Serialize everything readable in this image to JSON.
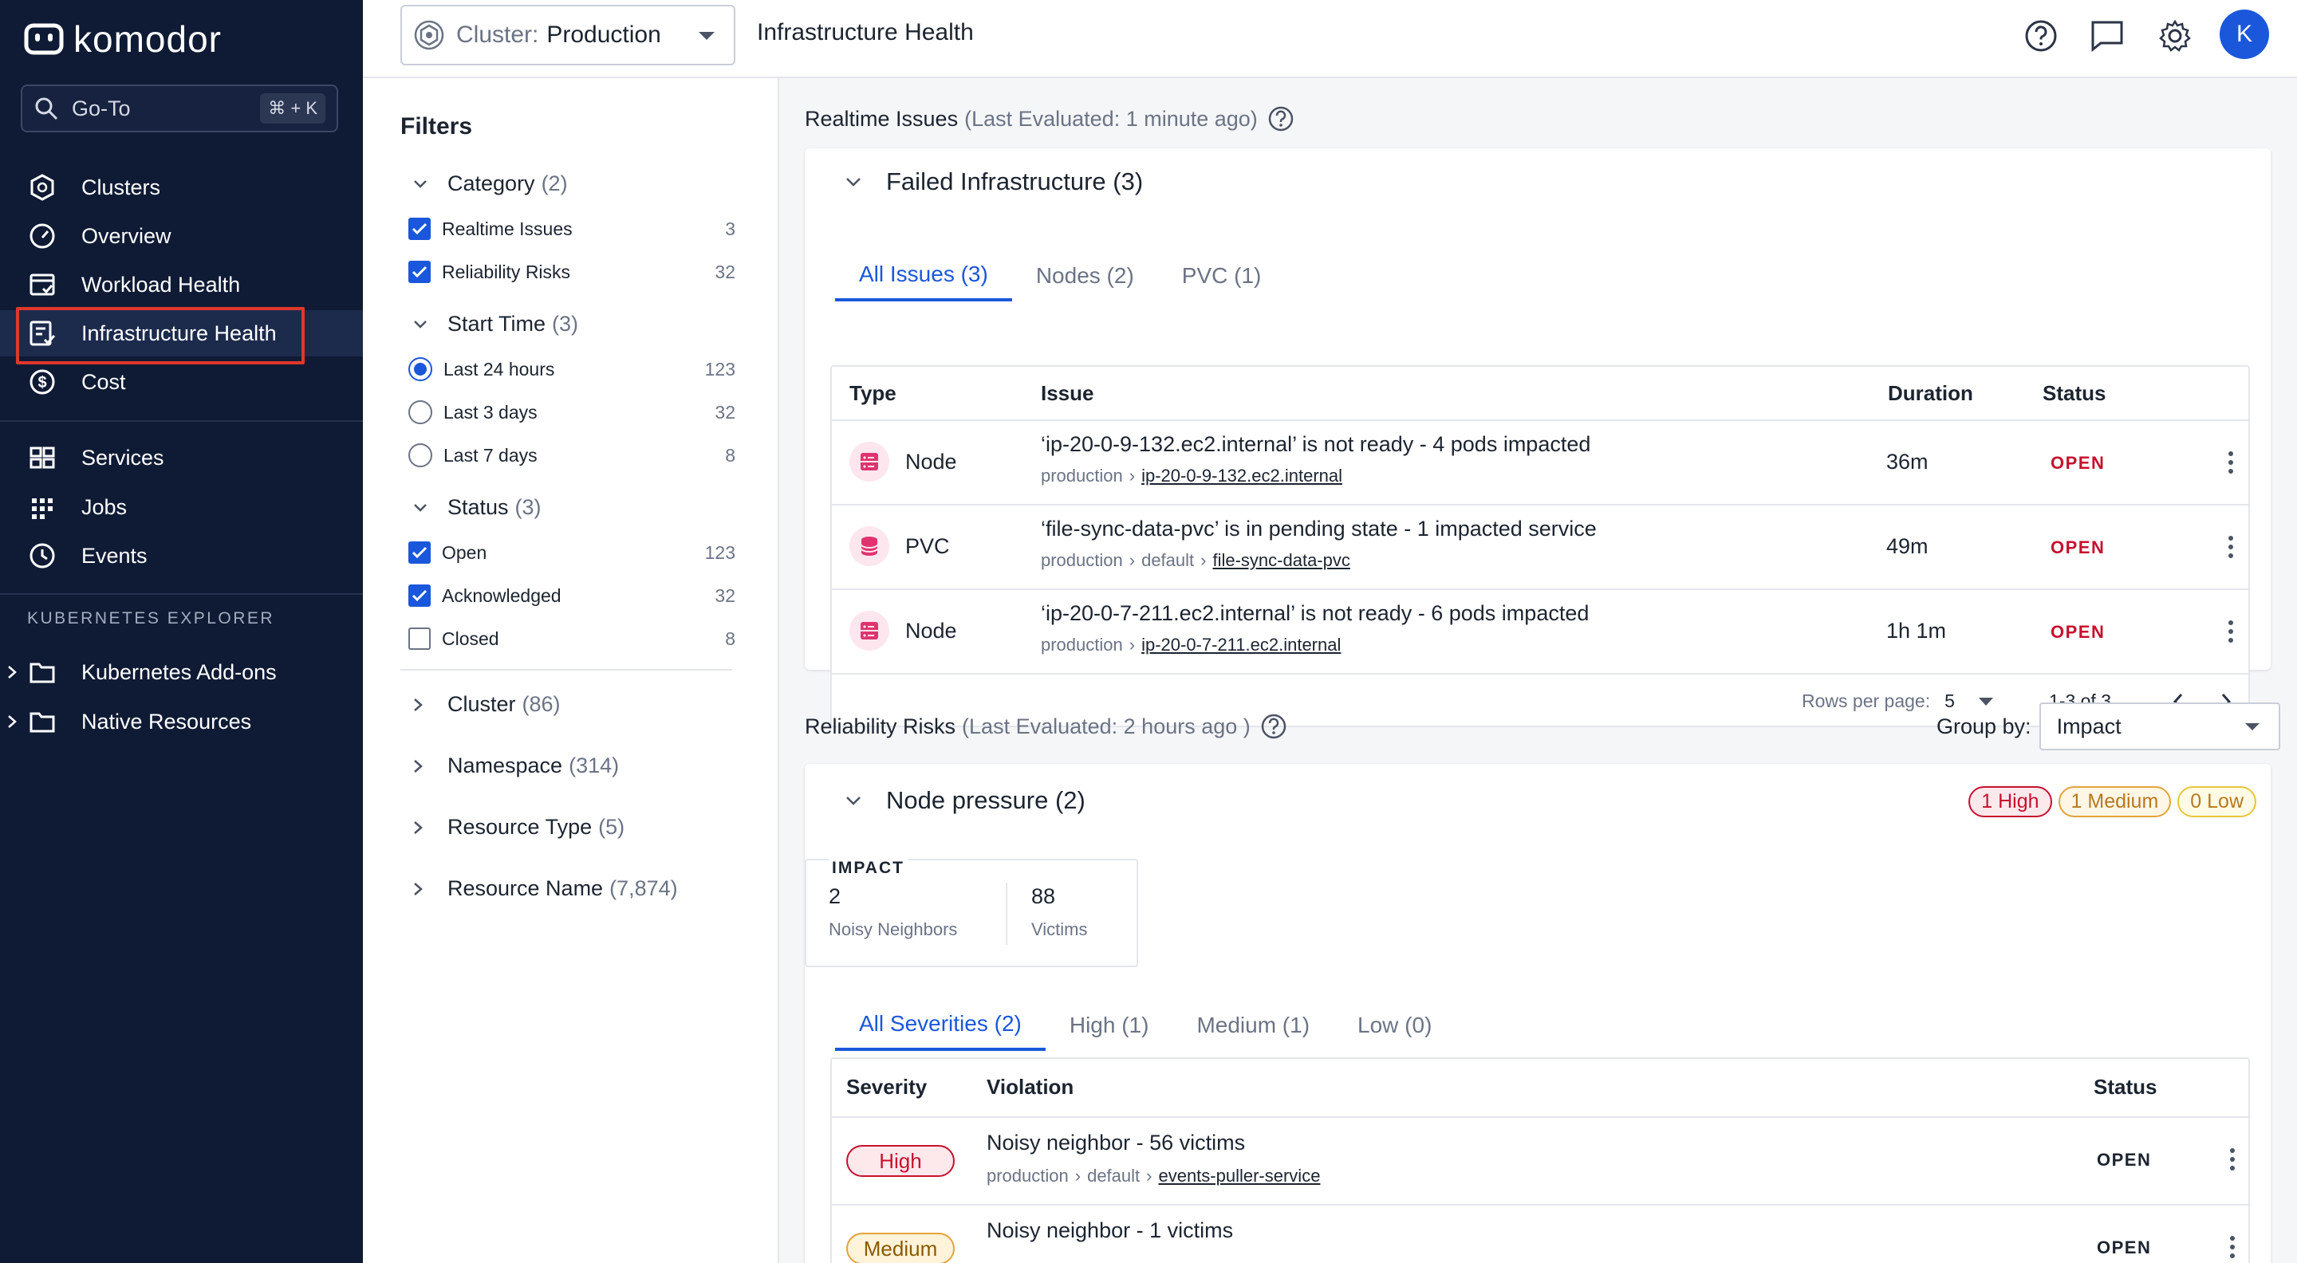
{
  "app": {
    "brand": "komodor",
    "goto_label": "Go-To",
    "goto_shortcut": "⌘ + K"
  },
  "sidebar": {
    "items": [
      {
        "label": "Clusters",
        "icon": "cluster-icon"
      },
      {
        "label": "Overview",
        "icon": "gauge-icon"
      },
      {
        "label": "Workload Health",
        "icon": "workload-health-icon"
      },
      {
        "label": "Infrastructure Health",
        "icon": "infrastructure-health-icon",
        "active": true
      },
      {
        "label": "Cost",
        "icon": "dollar-icon"
      },
      {
        "label": "Services",
        "icon": "services-grid-icon"
      },
      {
        "label": "Jobs",
        "icon": "jobs-dots-icon"
      },
      {
        "label": "Events",
        "icon": "clock-icon"
      }
    ],
    "section_label": "KUBERNETES EXPLORER",
    "tree": [
      {
        "label": "Kubernetes Add-ons",
        "icon": "folder-icon"
      },
      {
        "label": "Native Resources",
        "icon": "folder-icon"
      }
    ]
  },
  "topbar": {
    "cluster_label": "Cluster:",
    "cluster_value": "Production",
    "page_title": "Infrastructure Health",
    "avatar_initial": "K"
  },
  "filters": {
    "title": "Filters",
    "groups": [
      {
        "label": "Category",
        "count": "(2)",
        "options": [
          {
            "label": "Realtime Issues",
            "count": "3",
            "checked": true
          },
          {
            "label": "Reliability Risks",
            "count": "32",
            "checked": true
          }
        ]
      },
      {
        "label": "Start Time",
        "count": "(3)",
        "options": [
          {
            "label": "Last 24 hours",
            "count": "123",
            "checked": true
          },
          {
            "label": "Last 3 days",
            "count": "32",
            "checked": false
          },
          {
            "label": "Last 7 days",
            "count": "8",
            "checked": false
          }
        ]
      },
      {
        "label": "Status",
        "count": "(3)",
        "options": [
          {
            "label": "Open",
            "count": "123",
            "checked": true
          },
          {
            "label": "Acknowledged",
            "count": "32",
            "checked": true
          },
          {
            "label": "Closed",
            "count": "8",
            "checked": false
          }
        ]
      },
      {
        "label": "Cluster",
        "count": "(86)"
      },
      {
        "label": "Namespace",
        "count": "(314)"
      },
      {
        "label": "Resource Type",
        "count": "(5)"
      },
      {
        "label": "Resource Name",
        "count": "(7,874)"
      }
    ]
  },
  "realtime": {
    "title": "Realtime Issues",
    "evaluated": "(Last Evaluated: 1 minute ago)",
    "card_title": "Failed Infrastructure (3)",
    "tabs": [
      "All Issues (3)",
      "Nodes (2)",
      "PVC (1)"
    ],
    "columns": [
      "Type",
      "Issue",
      "Duration",
      "Status"
    ],
    "rows": [
      {
        "type": "Node",
        "icon": "node-server-icon",
        "issue": "‘ip-20-0-9-132.ec2.internal’ is not ready - 4 pods impacted",
        "path": [
          "production"
        ],
        "link": "ip-20-0-9-132.ec2.internal",
        "duration": "36m",
        "status": "OPEN"
      },
      {
        "type": "PVC",
        "icon": "pvc-database-icon",
        "issue": "‘file-sync-data-pvc’ is in pending state - 1 impacted service",
        "path": [
          "production",
          "default"
        ],
        "link": "file-sync-data-pvc",
        "duration": "49m",
        "status": "OPEN"
      },
      {
        "type": "Node",
        "icon": "node-server-icon",
        "issue": "‘ip-20-0-7-211.ec2.internal’ is not ready - 6 pods impacted",
        "path": [
          "production"
        ],
        "link": "ip-20-0-7-211.ec2.internal",
        "duration": "1h 1m",
        "status": "OPEN"
      }
    ],
    "pager": {
      "rows_label": "Rows per page:",
      "rows_value": "5",
      "range": "1-3 of 3"
    }
  },
  "risks": {
    "title": "Reliability Risks",
    "evaluated": "(Last Evaluated: 2 hours ago )",
    "group_by_label": "Group by:",
    "group_by_value": "Impact",
    "card_title": "Node pressure (2)",
    "pills": {
      "high": "1 High",
      "medium": "1 Medium",
      "low": "0 Low"
    },
    "impact": {
      "label": "IMPACT",
      "neighbors_value": "2",
      "neighbors_label": "Noisy Neighbors",
      "victims_value": "88",
      "victims_label": "Victims"
    },
    "tabs": [
      "All Severities (2)",
      "High (1)",
      "Medium (1)",
      "Low (0)"
    ],
    "columns": [
      "Severity",
      "Violation",
      "Status"
    ],
    "rows": [
      {
        "severity": "High",
        "violation": "Noisy neighbor - 56 victims",
        "path": [
          "production",
          "default"
        ],
        "link": "events-puller-service",
        "status": "OPEN"
      },
      {
        "severity": "Medium",
        "violation": "Noisy neighbor - 1 victims",
        "status": "OPEN"
      }
    ]
  },
  "colors": {
    "sidebar_bg": "#0f1b35",
    "accent": "#1a57db",
    "danger": "#c8102e",
    "highlight_box": "#e0372b"
  }
}
